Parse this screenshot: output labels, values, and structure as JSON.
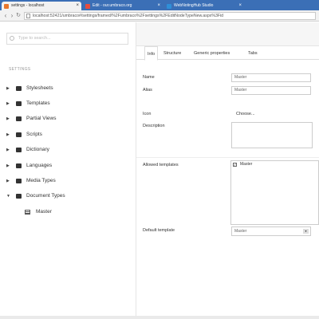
{
  "browser": {
    "tabs": [
      {
        "label": "settings - localhost",
        "active": true,
        "fav_color": "#e8762c"
      },
      {
        "label": "Edit - our.umbraco.org",
        "active": false,
        "fav_color": "#e84c3d"
      },
      {
        "label": "WebNotingHub Studio",
        "active": false,
        "fav_color": "#2f8fd8"
      }
    ],
    "url": "localhost:52421/umbraco#/settings/framed/%2Fumbraco%2Fsettings%2FEditNodeTypeNew.aspx%3Fid"
  },
  "left": {
    "search_placeholder": "Type to search...",
    "section_title": "SETTINGS",
    "tree": [
      {
        "label": "Stylesheets"
      },
      {
        "label": "Templates"
      },
      {
        "label": "Partial Views"
      },
      {
        "label": "Scripts"
      },
      {
        "label": "Dictionary"
      },
      {
        "label": "Languages"
      },
      {
        "label": "Media Types"
      },
      {
        "label": "Document Types"
      }
    ],
    "child": {
      "label": "Master"
    }
  },
  "content": {
    "tabs": [
      "Info",
      "Structure",
      "Generic properties",
      "Tabs"
    ],
    "fields": {
      "name_label": "Name",
      "name_value": "Master",
      "alias_label": "Alias",
      "alias_value": "Master",
      "icon_label": "Icon",
      "icon_value": "Choose...",
      "description_label": "Description",
      "allowed_label": "Allowed templates",
      "allowed_item": "Master",
      "default_label": "Default template",
      "default_value": "Master"
    }
  },
  "colors": {
    "tabbar": "#3b6fb6"
  }
}
